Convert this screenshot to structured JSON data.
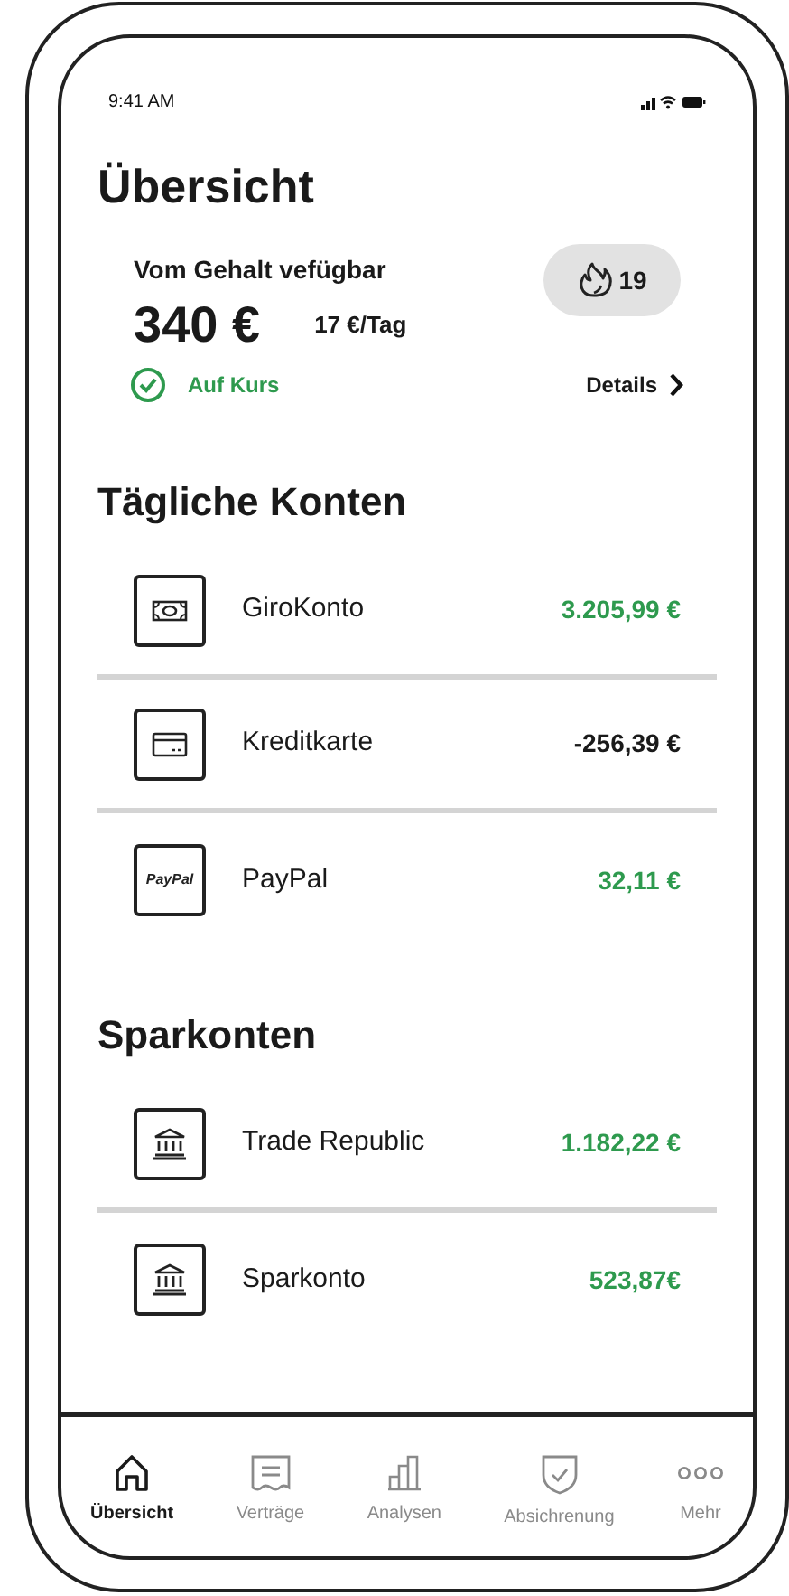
{
  "status_bar": {
    "time": "9:41 AM"
  },
  "title": "Übersicht",
  "budget": {
    "label": "Vom Gehalt vefügbar",
    "amount": "340 €",
    "per_day": "17 €/Tag",
    "streak": "19",
    "status": "Auf Kurs",
    "details": "Details"
  },
  "sections": [
    {
      "title": "Tägliche Konten",
      "accounts": [
        {
          "kind": "cash",
          "name": "GiroKonto",
          "amount": "3.205,99 €",
          "color": "#2e9a4e"
        },
        {
          "kind": "card",
          "name": "Kreditkarte",
          "amount": "-256,39 €",
          "color": "#1a1a1a"
        },
        {
          "kind": "paypal",
          "logo": "PayPal",
          "name": "PayPal",
          "amount": "32,11 €",
          "color": "#2e9a4e"
        }
      ]
    },
    {
      "title": "Sparkonten",
      "accounts": [
        {
          "kind": "bank",
          "name": "Trade Republic",
          "amount": "1.182,22 €",
          "color": "#2e9a4e"
        },
        {
          "kind": "bank",
          "name": "Sparkonto",
          "amount": "523,87€",
          "color": "#2e9a4e"
        }
      ]
    }
  ],
  "tab_bar": [
    {
      "kind": "home",
      "label": "Übersicht",
      "selected": true
    },
    {
      "kind": "contracts",
      "label": "Verträge",
      "selected": false
    },
    {
      "kind": "analytics",
      "label": "Analysen",
      "selected": false
    },
    {
      "kind": "insurance",
      "label": "Absichrenung",
      "selected": false
    },
    {
      "kind": "more",
      "label": "Mehr",
      "selected": false
    }
  ]
}
